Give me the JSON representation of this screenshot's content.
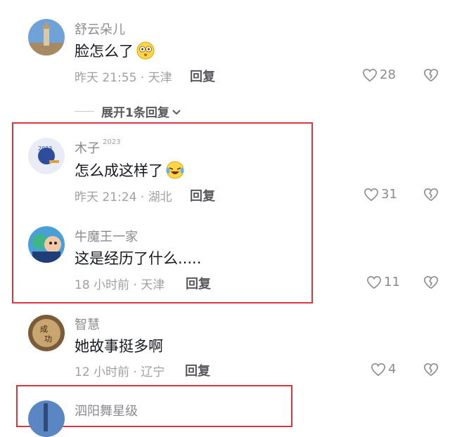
{
  "comments": [
    {
      "username": "舒云朵儿",
      "badge": "",
      "text": "脸怎么了",
      "emoji": "flushed-emoji",
      "meta": "昨天 21:55 · 天津",
      "reply": "回复",
      "likes": "28"
    },
    {
      "username": "木子",
      "badge": "2023",
      "text": "怎么成这样了",
      "emoji": "laughing-tears-emoji",
      "meta": "昨天 21:24 · 湖北",
      "reply": "回复",
      "likes": "31"
    },
    {
      "username": "牛魔王一家",
      "badge": "",
      "text": "这是经历了什么.....",
      "emoji": "",
      "meta": "18 小时前 · 天津",
      "reply": "回复",
      "likes": "11"
    },
    {
      "username": "智慧",
      "badge": "",
      "text": "她故事挺多啊",
      "emoji": "",
      "meta": "12 小时前 · 辽宁",
      "reply": "回复",
      "likes": "4"
    },
    {
      "username": "泗阳舞星级",
      "badge": "",
      "text": "",
      "emoji": "",
      "meta": "",
      "reply": "",
      "likes": ""
    }
  ],
  "expand_replies": "展开1条回复",
  "colors": {
    "highlight_box": "#d9363e",
    "username": "#8a8b91",
    "meta": "#9fa0a6",
    "text": "#161823"
  }
}
